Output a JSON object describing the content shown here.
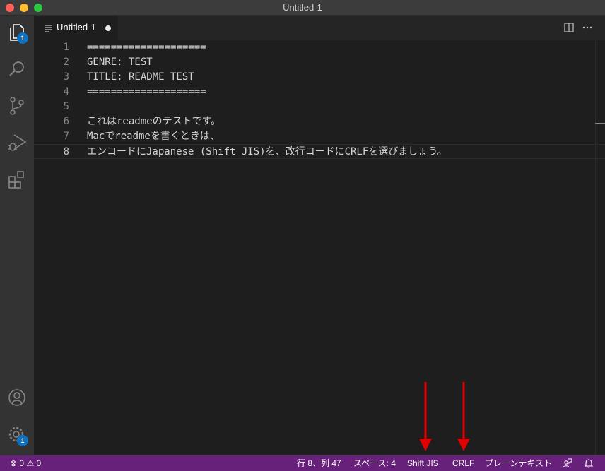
{
  "window": {
    "title": "Untitled-1"
  },
  "activity_bar": {
    "items": [
      {
        "name": "explorer",
        "icon": "files-icon",
        "badge": "1"
      },
      {
        "name": "search",
        "icon": "search-icon"
      },
      {
        "name": "source-control",
        "icon": "source-control-icon"
      },
      {
        "name": "run-debug",
        "icon": "run-debug-icon"
      },
      {
        "name": "extensions",
        "icon": "extensions-icon"
      }
    ],
    "bottom": [
      {
        "name": "accounts",
        "icon": "account-icon"
      },
      {
        "name": "manage",
        "icon": "gear-icon",
        "badge": "1"
      }
    ]
  },
  "tabs": [
    {
      "label": "Untitled-1",
      "dirty": true,
      "active": true
    }
  ],
  "editor": {
    "lines": [
      {
        "num": "1",
        "text": "===================="
      },
      {
        "num": "2",
        "text": "GENRE: TEST"
      },
      {
        "num": "3",
        "text": "TITLE: README TEST"
      },
      {
        "num": "4",
        "text": "===================="
      },
      {
        "num": "5",
        "text": ""
      },
      {
        "num": "6",
        "text": "これはreadmeのテストです。"
      },
      {
        "num": "7",
        "text": "Macでreadmeを書くときは、"
      },
      {
        "num": "8",
        "text": "エンコードにJapanese (Shift JIS)を、改行コードにCRLFを選びましょう。"
      }
    ],
    "current_line": 8
  },
  "status_bar": {
    "errors": "0",
    "warnings": "0",
    "position": "行 8、列 47",
    "indent": "スペース: 4",
    "encoding": "Shift JIS",
    "eol": "CRLF",
    "language": "プレーンテキスト"
  },
  "colors": {
    "status_bar_bg": "#68217a",
    "badge": "#0e70c0",
    "annotation_arrow": "#e00000"
  }
}
